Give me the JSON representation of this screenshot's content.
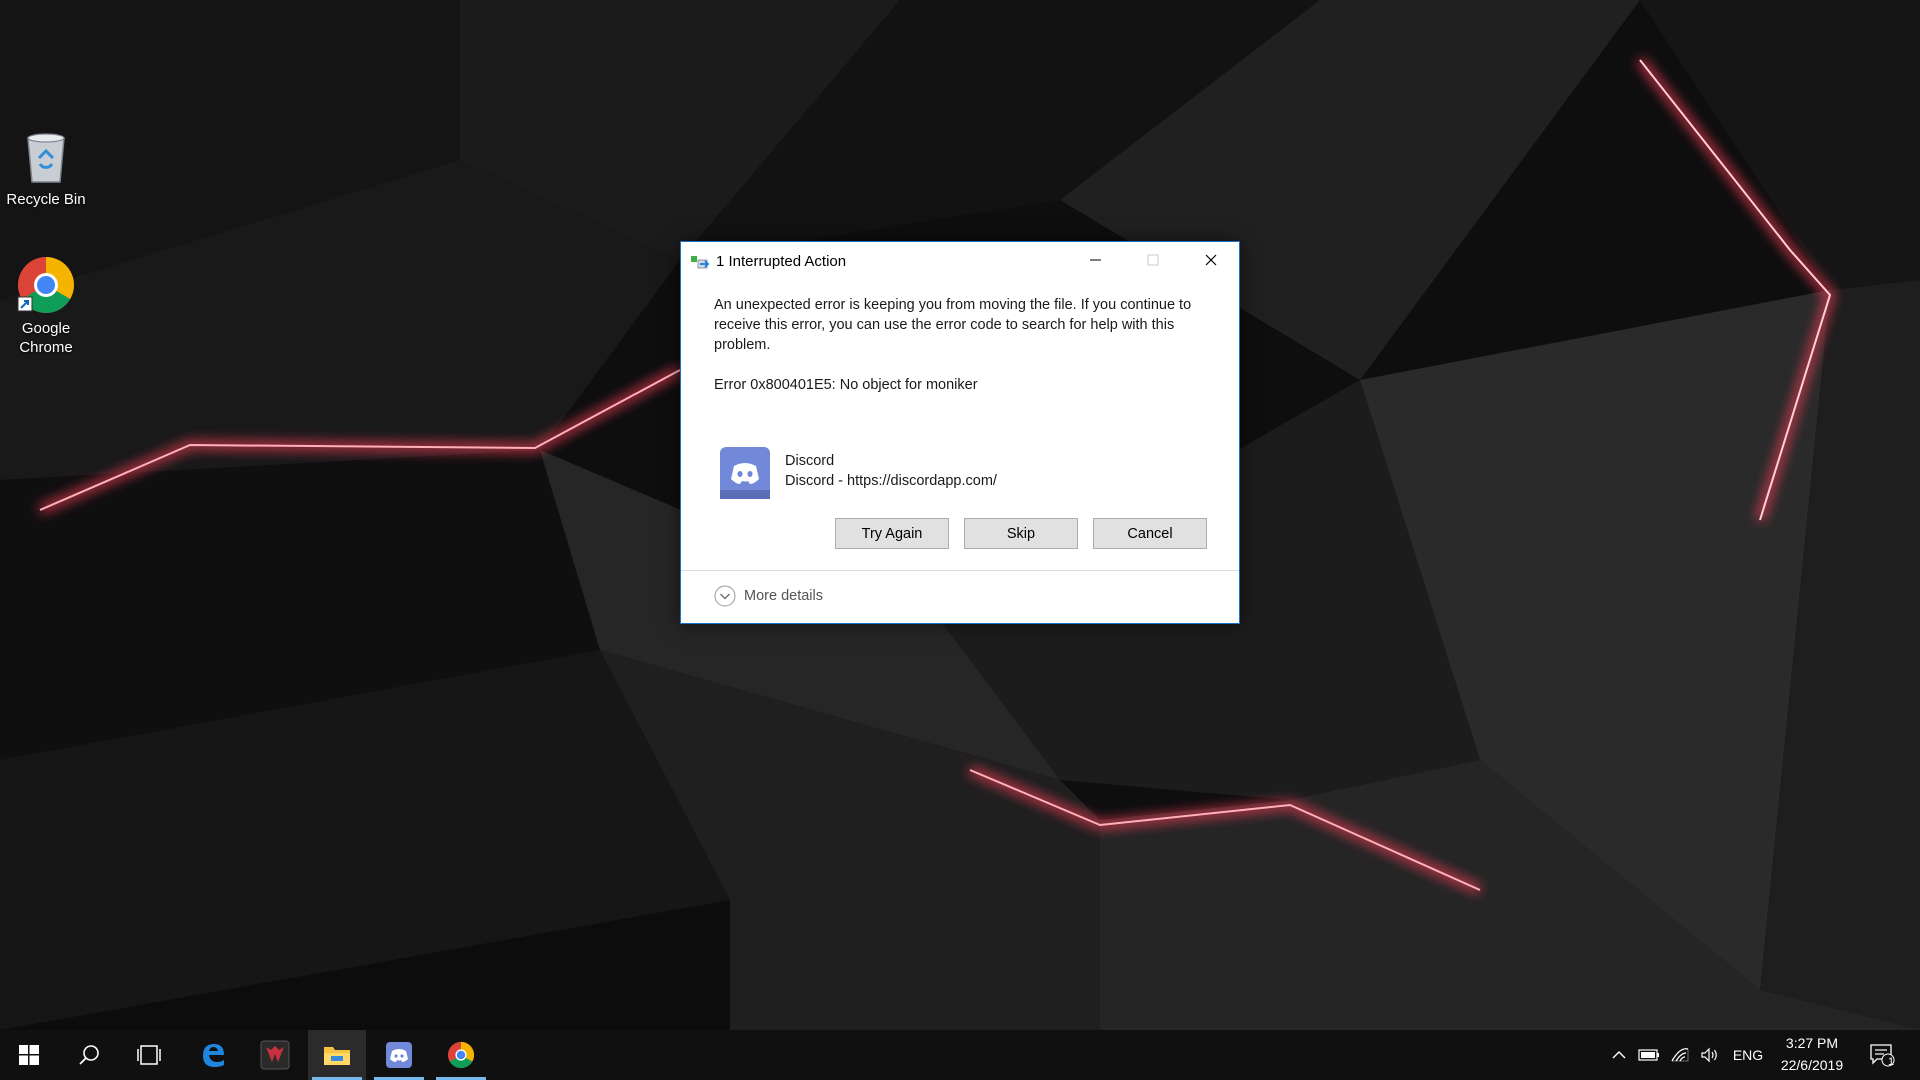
{
  "desktop": {
    "icons": [
      {
        "label": "Recycle Bin"
      },
      {
        "label": "Google\nChrome"
      }
    ]
  },
  "dialog": {
    "title": "1 Interrupted Action",
    "message": "An unexpected error is keeping you from moving the file. If you continue to receive this error, you can use the error code to search for help with this problem.",
    "error": "Error 0x800401E5: No object for moniker",
    "file_name": "Discord",
    "file_description": "Discord - https://discordapp.com/",
    "buttons": {
      "try_again": "Try Again",
      "skip": "Skip",
      "cancel": "Cancel"
    },
    "more_details": "More details"
  },
  "taskbar": {
    "language": "ENG",
    "time": "3:27 PM",
    "date": "22/6/2019",
    "notification_count": "1"
  },
  "colors": {
    "dialog_border": "#1a73c6",
    "discord_blurple": "#7289da",
    "taskbar_accent": "#76b9ed"
  }
}
